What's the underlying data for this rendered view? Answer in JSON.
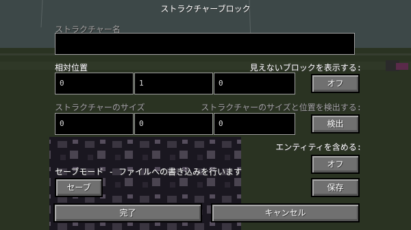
{
  "title": "ストラクチャーブロック",
  "structure_name": {
    "label": "ストラクチャー名",
    "value": ""
  },
  "relative_position": {
    "label": "相対位置",
    "x": "0",
    "y": "1",
    "z": "0"
  },
  "show_invisible": {
    "label": "見えないブロックを表示する:",
    "button": "オフ"
  },
  "structure_size": {
    "label": "ストラクチャーのサイズ",
    "x": "0",
    "y": "0",
    "z": "0"
  },
  "detect": {
    "label": "ストラクチャーのサイズと位置を検出する:",
    "button": "検出"
  },
  "include_entities": {
    "label": "エンティティを含める:",
    "button": "オフ"
  },
  "mode": {
    "label": "セーブモード - ファイルへの書き込みを行います",
    "button": "セーブ"
  },
  "save_button": "保存",
  "done_button": "完了",
  "cancel_button": "キャンセル"
}
